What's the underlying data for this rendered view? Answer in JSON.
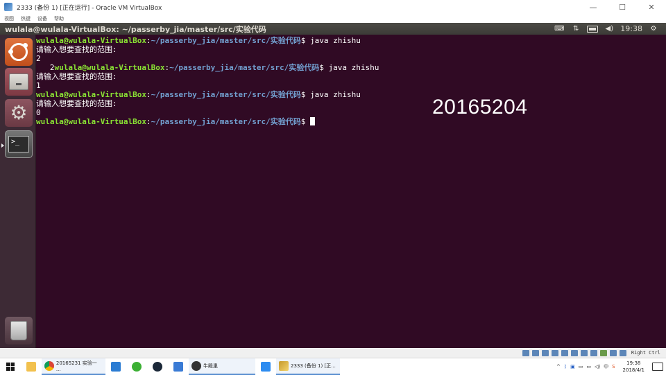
{
  "window": {
    "title": "2333 (备份 1) [正在运行] - Oracle VM VirtualBox",
    "minimize_glyph": "—",
    "maximize_glyph": "☐",
    "close_glyph": "✕"
  },
  "menubar": [
    "视图",
    "热键",
    "设备",
    "帮助"
  ],
  "ubuntu_panel": {
    "title": "wulala@wulala-VirtualBox: ~/passerby_jia/master/src/实验代码",
    "time": "19:38",
    "indicators": [
      "keyboard-icon",
      "network-icon",
      "battery-icon",
      "volume-icon",
      "settings-icon"
    ]
  },
  "launcher": {
    "items": [
      "dash-home",
      "files",
      "system-settings",
      "terminal",
      "trash"
    ]
  },
  "terminal": {
    "prompt_user": "wulala@wulala-VirtualBox",
    "prompt_path": "~/passerby_jia/master/src/实验代码",
    "lines": [
      {
        "kind": "cmd",
        "pre": "",
        "cmd": " java zhishu"
      },
      {
        "kind": "out",
        "text": "请输入想要查找的范围:"
      },
      {
        "kind": "out",
        "text": "2"
      },
      {
        "kind": "cmd",
        "pre": "   2",
        "cmd": " java zhishu"
      },
      {
        "kind": "out",
        "text": "请输入想要查找的范围:"
      },
      {
        "kind": "out",
        "text": "1"
      },
      {
        "kind": "cmd",
        "pre": "",
        "cmd": " java zhishu"
      },
      {
        "kind": "out",
        "text": "请输入想要查找的范围:"
      },
      {
        "kind": "out",
        "text": "0"
      },
      {
        "kind": "prompt",
        "pre": "",
        "cmd": " "
      }
    ],
    "watermark": "20165204"
  },
  "statusbar": {
    "host_key": "Right Ctrl"
  },
  "taskbar": {
    "chrome_label": "20165231 实验一 ...",
    "app2_label": "牛殿巢",
    "vbox_label": "2333 (备份 1) [正...",
    "ime": "中",
    "time": "19:38",
    "date": "2018/4/1"
  },
  "colors": {
    "terminal_bg": "#300a24",
    "prompt_user": "#8ae234",
    "prompt_path": "#729fcf",
    "launcher_bg": "#3d2a35",
    "panel_bg": "#3c3b37"
  }
}
